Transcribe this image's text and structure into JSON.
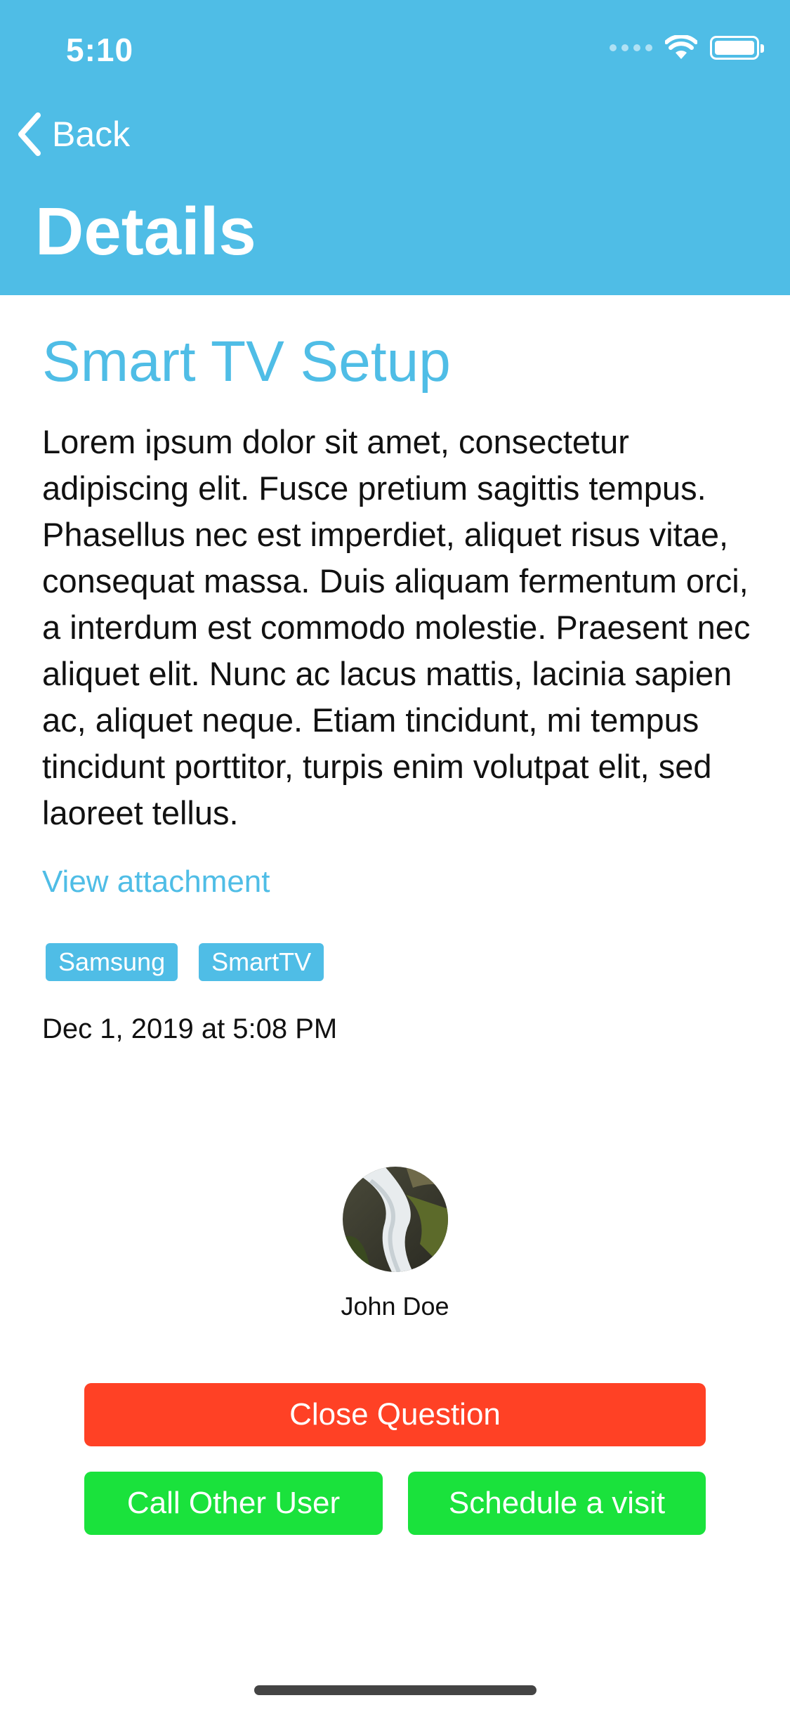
{
  "status_bar": {
    "time": "5:10"
  },
  "nav": {
    "back_label": "Back",
    "title": "Details"
  },
  "question": {
    "title": "Smart TV Setup",
    "body": "Lorem ipsum dolor sit amet, consectetur adipiscing elit. Fusce pretium sagittis tempus. Phasellus nec est imperdiet, aliquet risus vitae, consequat massa. Duis aliquam fermentum orci, a interdum est commodo molestie. Praesent nec aliquet elit. Nunc ac lacus mattis, lacinia sapien ac, aliquet neque. Etiam tincidunt, mi tempus tincidunt porttitor, turpis enim volutpat elit, sed laoreet tellus.",
    "attachment_link": "View attachment",
    "tags": [
      "Samsung",
      "SmartTV"
    ],
    "date": "Dec 1, 2019 at 5:08 PM"
  },
  "user": {
    "name": "John Doe"
  },
  "actions": {
    "close": "Close Question",
    "call": "Call Other User",
    "visit": "Schedule a visit"
  },
  "colors": {
    "accent": "#4FBDE6",
    "danger": "#FF4125",
    "success": "#1AE23C"
  }
}
